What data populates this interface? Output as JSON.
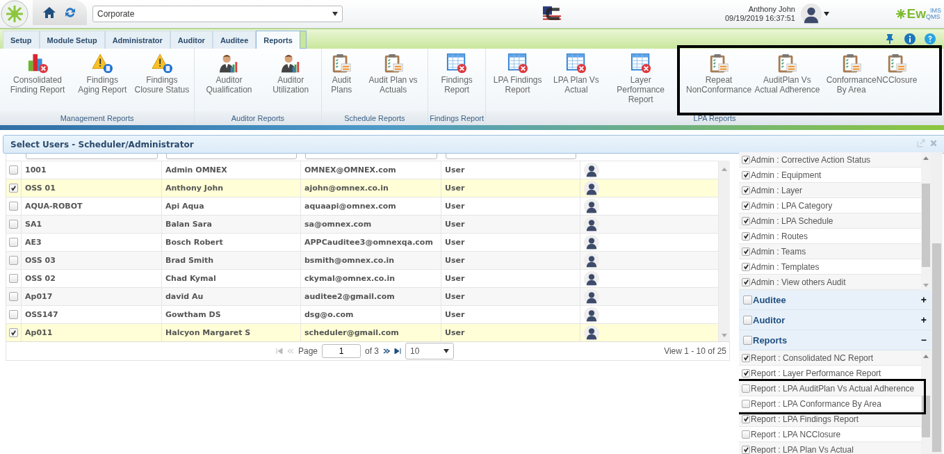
{
  "header": {
    "site": "Corporate",
    "user_name": "Anthony John",
    "datetime": "09/19/2019 16:37:51",
    "logo": {
      "text": "Ew",
      "sup": "IMS",
      "sub": "QMS"
    }
  },
  "tabs": [
    {
      "label": "Setup",
      "selected": false
    },
    {
      "label": "Module Setup",
      "selected": false
    },
    {
      "label": "Administrator",
      "selected": false
    },
    {
      "label": "Auditor",
      "selected": false
    },
    {
      "label": "Auditee",
      "selected": false
    },
    {
      "label": "Reports",
      "selected": true
    }
  ],
  "ribbon_groups": [
    {
      "label": "Management Reports",
      "items": [
        {
          "label": "Consolidated Finding Report",
          "kind": "chart"
        },
        {
          "label": "Findings Aging Report",
          "kind": "warning"
        },
        {
          "label": "Findings Closure Status",
          "kind": "warning"
        }
      ]
    },
    {
      "label": "Auditor Reports",
      "items": [
        {
          "label": "Auditor Qualification",
          "kind": "user"
        },
        {
          "label": "Auditor Utilization",
          "kind": "user"
        }
      ]
    },
    {
      "label": "Schedule Reports",
      "items": [
        {
          "label": "Audit Plans",
          "kind": "clipboard"
        },
        {
          "label": "Audit Plan vs Actuals",
          "kind": "clipboard"
        }
      ]
    },
    {
      "label": "Findings Report",
      "items": [
        {
          "label": "Findings Report",
          "kind": "table"
        }
      ]
    },
    {
      "label": "LPA Reports",
      "items": [
        {
          "label": "LPA Findings Report",
          "kind": "table"
        },
        {
          "label": "LPA Plan Vs Actual",
          "kind": "table"
        },
        {
          "label": "Layer Performance Report",
          "kind": "table"
        },
        {
          "label": "Repeat NonConformance",
          "kind": "clipboard"
        },
        {
          "label": "AuditPlan Vs Actual Adherence",
          "kind": "clipboard"
        },
        {
          "label": "Conformance By Area",
          "kind": "clipboard"
        },
        {
          "label": "NCClosure",
          "kind": "clipboard"
        }
      ]
    }
  ],
  "panel": {
    "title": "Select Users - Scheduler/Administrator"
  },
  "users": [
    {
      "code": "1001",
      "name": "Admin OMNEX",
      "email": "OMNEX@OMNEX.com",
      "role": "User",
      "selected": false
    },
    {
      "code": "OSS 01",
      "name": "Anthony John",
      "email": "ajohn@omnex.co.in",
      "role": "User",
      "selected": true
    },
    {
      "code": "AQUA-ROBOT",
      "name": "Api Aqua",
      "email": "aquaapi@omnex.com",
      "role": "User",
      "selected": false
    },
    {
      "code": "SA1",
      "name": "Balan Sara",
      "email": "sa@omnex.com",
      "role": "User",
      "selected": false
    },
    {
      "code": "AE3",
      "name": "Bosch Robert",
      "email": "APPCauditee3@omnexqa.com",
      "role": "User",
      "selected": false
    },
    {
      "code": "OSS 03",
      "name": "Brad Smith",
      "email": "bsmith@omnex.co.in",
      "role": "User",
      "selected": false
    },
    {
      "code": "OSS 02",
      "name": "Chad Kymal",
      "email": "ckymal@omnex.co.in",
      "role": "User",
      "selected": false
    },
    {
      "code": "Ap017",
      "name": "david Au",
      "email": "auditee2@gmail.com",
      "role": "User",
      "selected": false
    },
    {
      "code": "OSS147",
      "name": "Gowtham DS",
      "email": "dsg@o.com",
      "role": "User",
      "selected": false
    },
    {
      "code": "Ap011",
      "name": "Halcyon Margaret  S",
      "email": "scheduler@gmail.com",
      "role": "User",
      "selected": true
    }
  ],
  "pager": {
    "page_label": "Page",
    "page": "1",
    "of": "of 3",
    "page_size": "10",
    "summary": "View 1 - 10 of 25"
  },
  "permissions": {
    "top_items": [
      {
        "label": "Admin : Corrective Action Status",
        "checked": true
      },
      {
        "label": "Admin : Equipment",
        "checked": true
      },
      {
        "label": "Admin : Layer",
        "checked": true
      },
      {
        "label": "Admin : LPA Category",
        "checked": true
      },
      {
        "label": "Admin : LPA Schedule",
        "checked": true
      },
      {
        "label": "Admin : Routes",
        "checked": true
      },
      {
        "label": "Admin : Teams",
        "checked": true
      },
      {
        "label": "Admin : Templates",
        "checked": true
      },
      {
        "label": "Admin : View others Audit",
        "checked": true
      }
    ],
    "sections": [
      {
        "label": "Auditee",
        "checked": false,
        "sign": "+"
      },
      {
        "label": "Auditor",
        "checked": false,
        "sign": "+"
      },
      {
        "label": "Reports",
        "checked": false,
        "sign": "−",
        "items": [
          {
            "label": "Report : Consolidated NC Report",
            "checked": true
          },
          {
            "label": "Report : Layer Performance Report",
            "checked": true
          },
          {
            "label": "Report : LPA AuditPlan Vs Actual Adherence",
            "checked": false
          },
          {
            "label": "Report : LPA Conformance By Area",
            "checked": false
          },
          {
            "label": "Report : LPA Findings Report",
            "checked": true
          },
          {
            "label": "Report : LPA NCClosure",
            "checked": false
          },
          {
            "label": "Report : LPA Plan Vs Actual",
            "checked": true
          }
        ]
      }
    ]
  }
}
